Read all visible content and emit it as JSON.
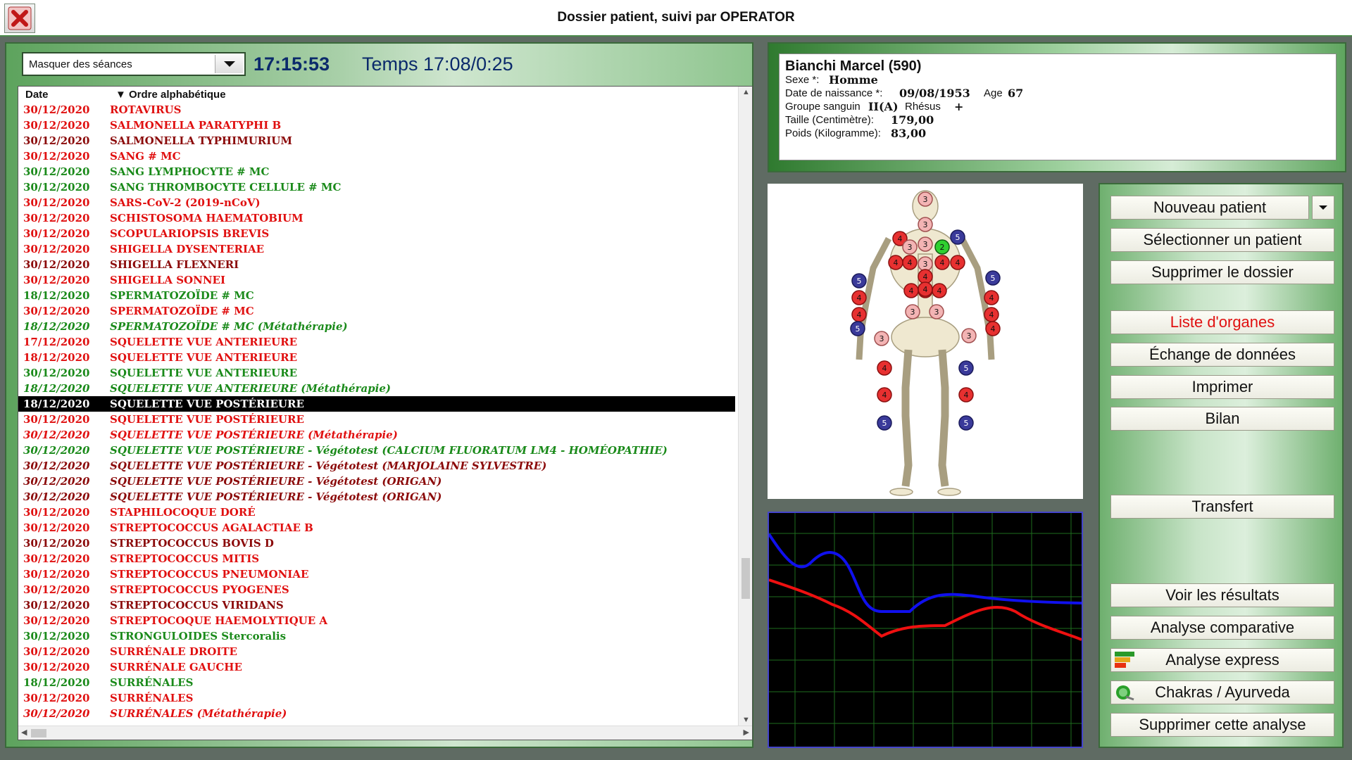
{
  "window": {
    "title": "Dossier patient, suivi par OPERATOR"
  },
  "toolbar": {
    "session_filter": "Masquer des séances",
    "clock": "17:15:53",
    "timer": "Temps 17:08/0:25"
  },
  "list": {
    "col_date": "Date",
    "col_name": "▼ Ordre alphabétique",
    "rows": [
      {
        "date": "30/12/2020",
        "name": "ROTAVIRUS",
        "color": "#e01010",
        "italic": false
      },
      {
        "date": "30/12/2020",
        "name": "SALMONELLA PARATYPHI B",
        "color": "#e01010",
        "italic": false
      },
      {
        "date": "30/12/2020",
        "name": "SALMONELLA TYPHIMURIUM",
        "color": "#8b0a0a",
        "italic": false
      },
      {
        "date": "30/12/2020",
        "name": "SANG # MC",
        "color": "#e01010",
        "italic": false
      },
      {
        "date": "30/12/2020",
        "name": "SANG LYMPHOCYTE # MC",
        "color": "#1a8a1a",
        "italic": false
      },
      {
        "date": "30/12/2020",
        "name": "SANG THROMBOCYTE CELLULE # MC",
        "color": "#1a8a1a",
        "italic": false
      },
      {
        "date": "30/12/2020",
        "name": "SARS-CoV-2 (2019-nCoV)",
        "color": "#e01010",
        "italic": false
      },
      {
        "date": "30/12/2020",
        "name": "SCHISTOSOMA HAEMATOBIUM",
        "color": "#e01010",
        "italic": false
      },
      {
        "date": "30/12/2020",
        "name": "SCOPULARIOPSIS BREVIS",
        "color": "#e01010",
        "italic": false
      },
      {
        "date": "30/12/2020",
        "name": "SHIGELLA DYSENTERIAE",
        "color": "#e01010",
        "italic": false
      },
      {
        "date": "30/12/2020",
        "name": "SHIGELLA FLEXNERI",
        "color": "#8b0a0a",
        "italic": false
      },
      {
        "date": "30/12/2020",
        "name": "SHIGELLA SONNEI",
        "color": "#e01010",
        "italic": false
      },
      {
        "date": "18/12/2020",
        "name": "SPERMATOZOÏDE # MC",
        "color": "#1a8a1a",
        "italic": false
      },
      {
        "date": "30/12/2020",
        "name": "SPERMATOZOÏDE # MC",
        "color": "#e01010",
        "italic": false
      },
      {
        "date": "18/12/2020",
        "name": "SPERMATOZOÏDE # MC (Métathérapie)",
        "color": "#1a8a1a",
        "italic": true
      },
      {
        "date": "17/12/2020",
        "name": "SQUELETTE VUE ANTERIEURE",
        "color": "#e01010",
        "italic": false
      },
      {
        "date": "18/12/2020",
        "name": "SQUELETTE VUE ANTERIEURE",
        "color": "#e01010",
        "italic": false
      },
      {
        "date": "30/12/2020",
        "name": "SQUELETTE VUE ANTERIEURE",
        "color": "#1a8a1a",
        "italic": false
      },
      {
        "date": "18/12/2020",
        "name": "SQUELETTE VUE ANTERIEURE (Métathérapie)",
        "color": "#1a8a1a",
        "italic": true
      },
      {
        "date": "18/12/2020",
        "name": "SQUELETTE VUE POSTÉRIEURE",
        "color": "#ffffff",
        "italic": false,
        "selected": true
      },
      {
        "date": "30/12/2020",
        "name": "SQUELETTE VUE POSTÉRIEURE",
        "color": "#e01010",
        "italic": false
      },
      {
        "date": "30/12/2020",
        "name": "SQUELETTE VUE POSTÉRIEURE (Métathérapie)",
        "color": "#e01010",
        "italic": true
      },
      {
        "date": "30/12/2020",
        "name": "SQUELETTE VUE POSTÉRIEURE - Végétotest (CALCIUM FLUORATUM LM4 - HOMÉOPATHIE)",
        "color": "#1a8a1a",
        "italic": true
      },
      {
        "date": "30/12/2020",
        "name": "SQUELETTE VUE POSTÉRIEURE - Végétotest (MARJOLAINE SYLVESTRE)",
        "color": "#8b0a0a",
        "italic": true
      },
      {
        "date": "30/12/2020",
        "name": "SQUELETTE VUE POSTÉRIEURE - Végétotest (ORIGAN)",
        "color": "#8b0a0a",
        "italic": true
      },
      {
        "date": "30/12/2020",
        "name": "SQUELETTE VUE POSTÉRIEURE - Végétotest (ORIGAN)",
        "color": "#8b0a0a",
        "italic": true
      },
      {
        "date": "30/12/2020",
        "name": "STAPHILOCOQUE DORÉ",
        "color": "#e01010",
        "italic": false
      },
      {
        "date": "30/12/2020",
        "name": "STREPTOCOCCUS AGALACTIAE B",
        "color": "#e01010",
        "italic": false
      },
      {
        "date": "30/12/2020",
        "name": "STREPTOCOCCUS BOVIS D",
        "color": "#8b0a0a",
        "italic": false
      },
      {
        "date": "30/12/2020",
        "name": "STREPTOCOCCUS MITIS",
        "color": "#e01010",
        "italic": false
      },
      {
        "date": "30/12/2020",
        "name": "STREPTOCOCCUS PNEUMONIAE",
        "color": "#e01010",
        "italic": false
      },
      {
        "date": "30/12/2020",
        "name": "STREPTOCOCCUS PYOGENES",
        "color": "#e01010",
        "italic": false
      },
      {
        "date": "30/12/2020",
        "name": "STREPTOCOCCUS VIRIDANS",
        "color": "#8b0a0a",
        "italic": false
      },
      {
        "date": "30/12/2020",
        "name": "STREPTOCOQUE HAEMOLYTIQUE A",
        "color": "#e01010",
        "italic": false
      },
      {
        "date": "30/12/2020",
        "name": "STRONGULOIDES Stercoralis",
        "color": "#1a8a1a",
        "italic": false
      },
      {
        "date": "30/12/2020",
        "name": "SURRÉNALE DROITE",
        "color": "#e01010",
        "italic": false
      },
      {
        "date": "30/12/2020",
        "name": "SURRÉNALE GAUCHE",
        "color": "#e01010",
        "italic": false
      },
      {
        "date": "18/12/2020",
        "name": "SURRÉNALES",
        "color": "#1a8a1a",
        "italic": false
      },
      {
        "date": "30/12/2020",
        "name": "SURRÉNALES",
        "color": "#e01010",
        "italic": false
      },
      {
        "date": "30/12/2020",
        "name": "SURRÉNALES (Métathérapie)",
        "color": "#e01010",
        "italic": true
      }
    ]
  },
  "patient": {
    "name": "Bianchi Marcel (590)",
    "sex_label": "Sexe *:",
    "sex": "Homme",
    "dob_label": "Date de naissance *:",
    "dob": "09/08/1953",
    "age_label": "Age",
    "age": "67",
    "blood_label": "Groupe sanguin",
    "blood": "II(A)",
    "rh_label": "Rhésus",
    "rh": "+",
    "height_label": "Taille (Centimètre):",
    "height": "179,00",
    "weight_label": "Poids (Kilogramme):",
    "weight": "83,00"
  },
  "skeleton_points": [
    {
      "v": "3",
      "c": "pink"
    },
    {
      "v": "3",
      "c": "pink"
    },
    {
      "v": "4",
      "c": "red"
    },
    {
      "v": "3",
      "c": "pink"
    },
    {
      "v": "3",
      "c": "pink"
    },
    {
      "v": "2",
      "c": "green"
    },
    {
      "v": "5",
      "c": "blue"
    },
    {
      "v": "4",
      "c": "red"
    },
    {
      "v": "4",
      "c": "red"
    },
    {
      "v": "3",
      "c": "pink"
    },
    {
      "v": "4",
      "c": "red"
    },
    {
      "v": "4",
      "c": "red"
    },
    {
      "v": "4",
      "c": "red"
    },
    {
      "v": "4",
      "c": "red"
    },
    {
      "v": "5",
      "c": "blue"
    },
    {
      "v": "5",
      "c": "blue"
    },
    {
      "v": "4",
      "c": "red"
    },
    {
      "v": "4",
      "c": "red"
    },
    {
      "v": "4",
      "c": "red"
    },
    {
      "v": "4",
      "c": "red"
    },
    {
      "v": "4",
      "c": "red"
    },
    {
      "v": "3",
      "c": "pink"
    },
    {
      "v": "3",
      "c": "pink"
    },
    {
      "v": "4",
      "c": "red"
    },
    {
      "v": "4",
      "c": "red"
    },
    {
      "v": "5",
      "c": "blue"
    },
    {
      "v": "4",
      "c": "red"
    },
    {
      "v": "3",
      "c": "pink"
    },
    {
      "v": "3",
      "c": "pink"
    },
    {
      "v": "4",
      "c": "red"
    },
    {
      "v": "5",
      "c": "blue"
    },
    {
      "v": "4",
      "c": "red"
    },
    {
      "v": "4",
      "c": "red"
    },
    {
      "v": "5",
      "c": "blue"
    },
    {
      "v": "5",
      "c": "blue"
    }
  ],
  "buttons": {
    "new_patient": "Nouveau patient",
    "select_patient": "Sélectionner un patient",
    "delete_file": "Supprimer le dossier",
    "organ_list": "Liste d'organes",
    "data_exchange": "Échange de données",
    "print": "Imprimer",
    "report": "Bilan",
    "transfer": "Transfert",
    "view_results": "Voir les résultats",
    "comparative": "Analyse comparative",
    "express": "Analyse express",
    "chakras": "Chakras / Ayurveda",
    "delete_analysis": "Supprimer cette analyse"
  },
  "colors": {
    "red": "#e01010",
    "green": "#1a8a1a",
    "dark_red": "#8b0a0a",
    "accent_blue": "#0b2a6b"
  }
}
